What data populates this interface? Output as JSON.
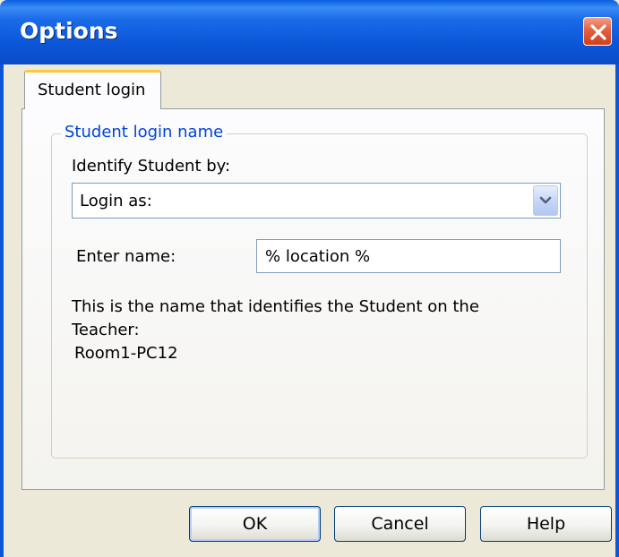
{
  "window": {
    "title": "Options"
  },
  "tabs": [
    {
      "label": "Student login"
    }
  ],
  "group": {
    "legend": "Student login name",
    "identify_label": "Identify Student by:",
    "identify_selected": "Login as:",
    "enter_name_label": "Enter name:",
    "enter_name_value": "% location %",
    "info_line1": "This is the name that identifies the Student on the",
    "info_line2": "Teacher:",
    "computed_name": "Room1-PC12"
  },
  "buttons": {
    "ok": "OK",
    "cancel": "Cancel",
    "help": "Help"
  },
  "icons": {
    "close": "close-icon",
    "dropdown": "chevron-down-icon"
  },
  "colors": {
    "titlebar": "#0B55D6",
    "accent": "#0046D5",
    "tab_highlight": "#FFC83C",
    "close": "#E5603D"
  }
}
